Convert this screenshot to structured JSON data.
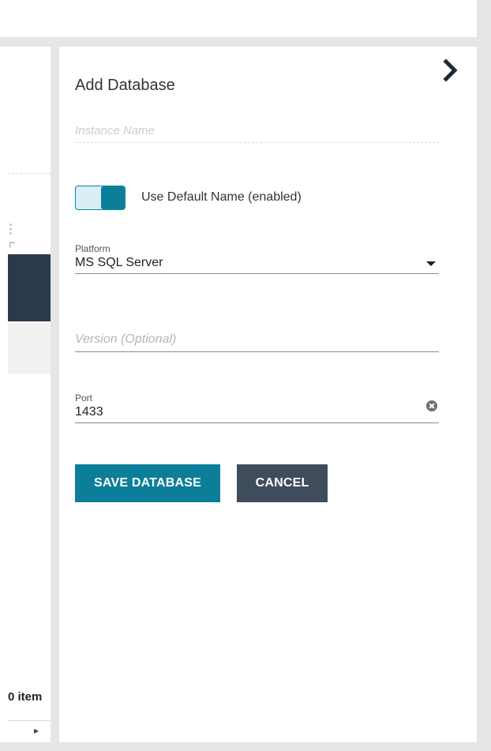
{
  "background_page": {
    "footer_items_text": "0 item"
  },
  "panel": {
    "title": "Add Database",
    "instance_name": {
      "placeholder": "Instance Name",
      "value": ""
    },
    "use_default_name": {
      "label": "Use Default Name (enabled)",
      "enabled": true
    },
    "platform": {
      "label": "Platform",
      "selected": "MS SQL Server"
    },
    "version": {
      "placeholder": "Version (Optional)",
      "value": ""
    },
    "port": {
      "label": "Port",
      "value": "1433"
    },
    "buttons": {
      "save_label": "SAVE DATABASE",
      "cancel_label": "CANCEL"
    },
    "icons": {
      "collapse": "chevron-right-icon",
      "clear": "clear-circle-icon",
      "dropdown": "caret-down-icon"
    }
  },
  "colors": {
    "primary": "#0c7e99",
    "secondary_button": "#3f4c5b",
    "frame_gray": "#e6e6e6"
  }
}
